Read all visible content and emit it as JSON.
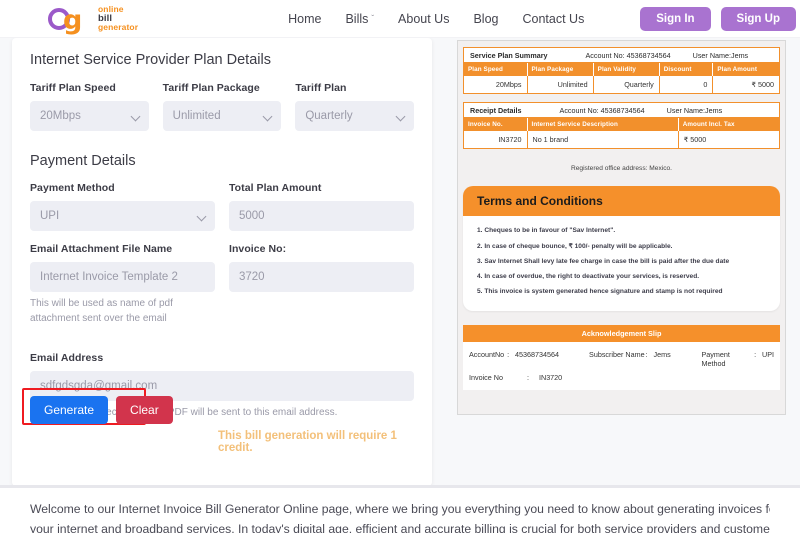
{
  "header": {
    "logo": {
      "line1": "online",
      "line2": "bill",
      "line3": "generator",
      "mark_o": "o",
      "mark_g": "g"
    },
    "nav": [
      {
        "label": "Home",
        "caret": false
      },
      {
        "label": "Bills",
        "caret": true
      },
      {
        "label": "About Us",
        "caret": false
      },
      {
        "label": "Blog",
        "caret": false
      },
      {
        "label": "Contact Us",
        "caret": false
      }
    ],
    "caret_glyph": "ˇ",
    "sign_in": "Sign In",
    "sign_up": "Sign Up"
  },
  "form": {
    "section_isp": "Internet Service Provider Plan Details",
    "section_payment": "Payment Details",
    "tariff_speed_label": "Tariff Plan Speed",
    "tariff_speed_value": "20Mbps",
    "tariff_package_label": "Tariff Plan Package",
    "tariff_package_value": "Unlimited",
    "tariff_plan_label": "Tariff Plan",
    "tariff_plan_value": "Quarterly",
    "payment_method_label": "Payment Method",
    "payment_method_value": "UPI",
    "total_amount_label": "Total Plan Amount",
    "total_amount_value": "5000",
    "attachment_label": "Email Attachment File Name",
    "attachment_value": "Internet Invoice Template 2",
    "attachment_helper": "This will be used as name of pdf attachment sent over the email",
    "invoice_no_label": "Invoice No:",
    "invoice_no_value": "3720",
    "email_label": "Email Address",
    "email_value": "sdfgdsgda@gmail.com",
    "email_helper": "Please enter correct email. Bill PDF will be sent to this email address.",
    "generate_label": "Generate",
    "clear_label": "Clear",
    "credit_note": "This bill generation will require 1 credit.",
    "accent_generate": "#1a73f0",
    "accent_clear": "#d2344c",
    "annotation_color": "#ef1b21"
  },
  "preview": {
    "plan_summary": {
      "title": "Service Plan Summary",
      "account": "Account No: 45368734564",
      "user": "User Name:Jems",
      "columns": [
        "Plan Speed",
        "Plan Package",
        "Plan Validity",
        "Discount",
        "Plan Amount"
      ],
      "row": [
        "20Mbps",
        "Unlimited",
        "Quarterly",
        "0",
        "₹ 5000"
      ]
    },
    "receipt": {
      "title": "Receipt Details",
      "account": "Account No: 45368734564",
      "user": "User Name:Jems",
      "columns": [
        "Invoice No.",
        "Internet Service Description",
        "Amount Incl. Tax"
      ],
      "row": [
        "IN3720",
        "No 1 brand",
        "₹ 5000"
      ]
    },
    "registered_office": "Registered office address: Mexico.",
    "terms_title": "Terms and Conditions",
    "terms": [
      "1. Cheques to be in favour of \"Sav Internet\".",
      "2. In case of cheque bounce, ₹ 100/- penalty will be applicable.",
      "3. Sav Internet Shall levy late fee charge in case the bill is paid after the due date",
      "4. In case of overdue, the right to deactivate your services, is reserved.",
      "5. This invoice is system generated hence signature and stamp is not required"
    ],
    "ack_title": "Acknowledgement Slip",
    "ack": {
      "account_key": "AccountNo",
      "account_value": "45368734564",
      "subscriber_key": "Subscriber Name",
      "subscriber_value": "Jems",
      "method_key": "Payment Method",
      "method_value": "UPI",
      "invoice_key": "Invoice No",
      "invoice_value": "IN3720",
      "colon": ":"
    },
    "accent_orange": "#f2902c"
  },
  "article": {
    "line1": "Welcome to our Internet Invoice Bill Generator Online page, where we bring you everything you need to know about generating invoices for",
    "line2": "your internet and broadband services. In today's digital age, efficient and accurate billing is crucial for both service providers and customers"
  }
}
